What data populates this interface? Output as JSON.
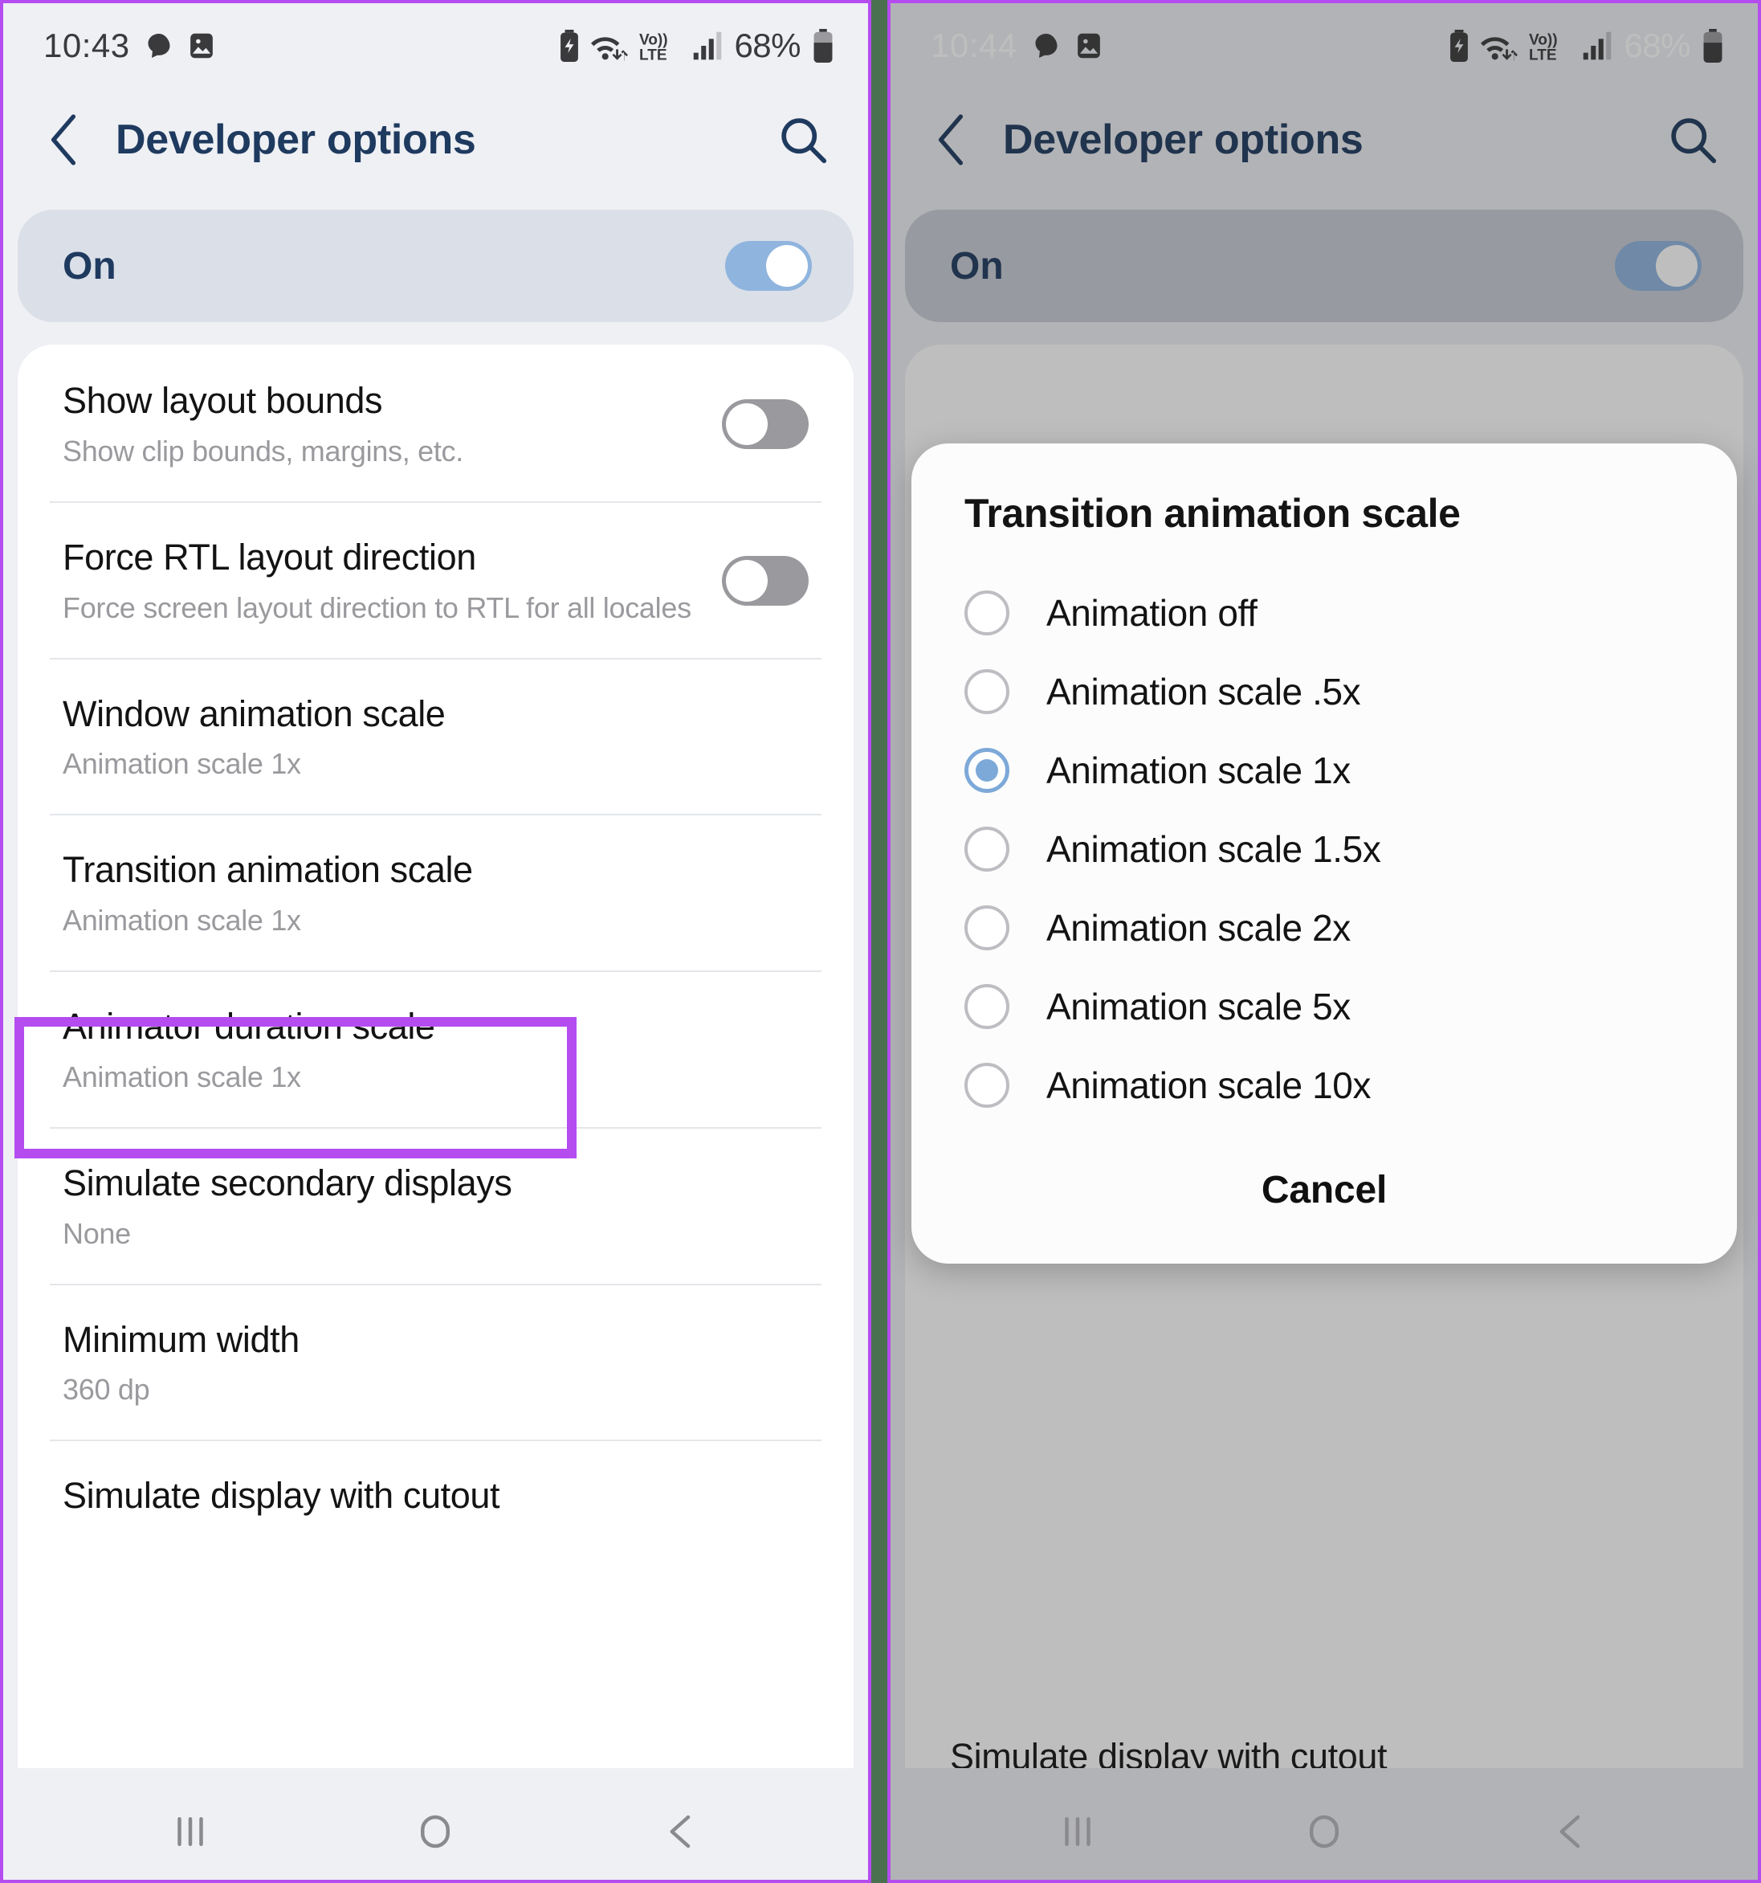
{
  "annotation": {
    "highlight_color": "#b44cf0",
    "divider_color": "#4a7050"
  },
  "left_phone": {
    "status_bar": {
      "time": "10:43",
      "battery_percent": "68%",
      "icons": [
        "chat-bubble-icon",
        "image-icon",
        "battery-saver-icon",
        "wifi-icon",
        "volte-icon",
        "signal-bars-icon",
        "battery-icon"
      ]
    },
    "header": {
      "back_label": "back-arrow",
      "title": "Developer options",
      "search_label": "search"
    },
    "master_switch": {
      "label": "On",
      "state": "on"
    },
    "rows": [
      {
        "title": "Show layout bounds",
        "subtitle": "Show clip bounds, margins, etc.",
        "toggle": "off"
      },
      {
        "title": "Force RTL layout direction",
        "subtitle": "Force screen layout direction to RTL for all locales",
        "toggle": "off"
      },
      {
        "title": "Window animation scale",
        "subtitle": "Animation scale 1x",
        "toggle": null
      },
      {
        "title": "Transition animation scale",
        "subtitle": "Animation scale 1x",
        "toggle": null,
        "highlighted": true
      },
      {
        "title": "Animator duration scale",
        "subtitle": "Animation scale 1x",
        "toggle": null
      },
      {
        "title": "Simulate secondary displays",
        "subtitle": "None",
        "toggle": null
      },
      {
        "title": "Minimum width",
        "subtitle": "360 dp",
        "toggle": null
      }
    ],
    "clipped_row_title": "Simulate display with cutout",
    "nav_bar": {
      "recents": "recents-icon",
      "home": "home-icon",
      "back": "back-icon"
    }
  },
  "right_phone": {
    "status_bar": {
      "time": "10:44",
      "battery_percent": "68%"
    },
    "header": {
      "title": "Developer options"
    },
    "master_switch": {
      "label": "On",
      "state": "on"
    },
    "dialog": {
      "title": "Transition animation scale",
      "options": [
        {
          "label": "Animation off",
          "selected": false,
          "highlighted": true
        },
        {
          "label": "Animation scale .5x",
          "selected": false
        },
        {
          "label": "Animation scale 1x",
          "selected": true
        },
        {
          "label": "Animation scale 1.5x",
          "selected": false
        },
        {
          "label": "Animation scale 2x",
          "selected": false
        },
        {
          "label": "Animation scale 5x",
          "selected": false
        },
        {
          "label": "Animation scale 10x",
          "selected": false
        }
      ],
      "cancel_label": "Cancel"
    },
    "clipped_row_title": "Simulate display with cutout",
    "nav_bar": {
      "recents": "recents-icon",
      "home": "home-icon",
      "back": "back-icon"
    }
  }
}
